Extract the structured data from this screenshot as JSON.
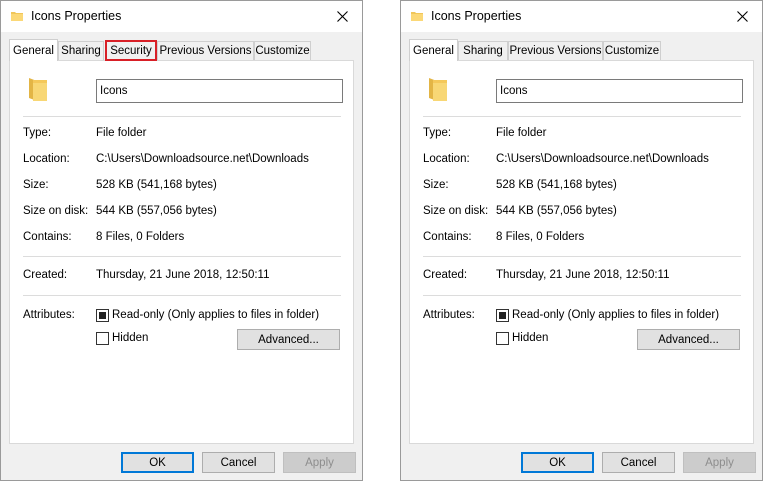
{
  "window": {
    "title": "Icons Properties"
  },
  "tabs": [
    "General",
    "Sharing",
    "Security",
    "Previous Versions",
    "Customize"
  ],
  "general": {
    "name": "Icons",
    "type_label": "Type:",
    "type_value": "File folder",
    "location_label": "Location:",
    "location_value": "C:\\Users\\Downloadsource.net\\Downloads",
    "size_label": "Size:",
    "size_value": "528 KB (541,168 bytes)",
    "size_on_disk_label": "Size on disk:",
    "size_on_disk_value": "544 KB (557,056 bytes)",
    "contains_label": "Contains:",
    "contains_value": "8 Files, 0 Folders",
    "created_label": "Created:",
    "created_value": "Thursday, 21 June 2018, 12:50:11",
    "attributes_label": "Attributes:",
    "readonly_label": "Read-only (Only applies to files in folder)",
    "readonly_checked": true,
    "hidden_label": "Hidden",
    "hidden_checked": false,
    "advanced_label": "Advanced..."
  },
  "buttons": {
    "ok": "OK",
    "cancel": "Cancel",
    "apply": "Apply"
  },
  "highlight": {
    "color": "#d81f26"
  }
}
